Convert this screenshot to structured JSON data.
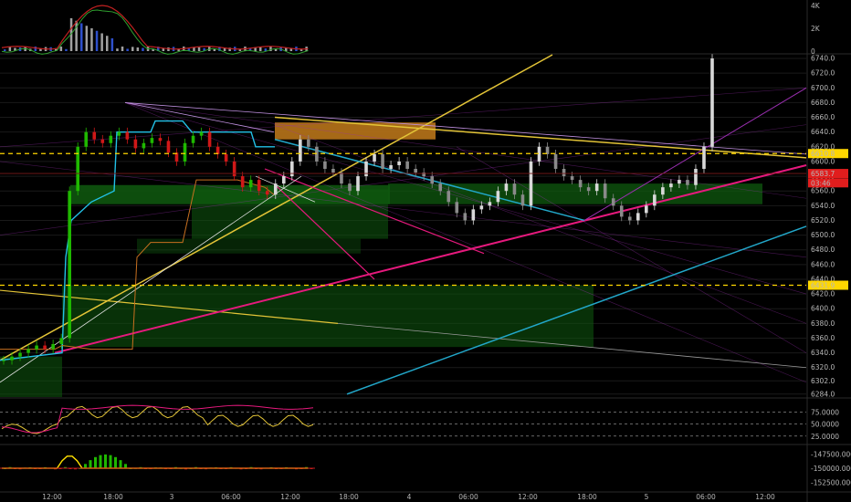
{
  "chart_data": {
    "type": "line",
    "colors": {
      "background": "#000000",
      "candle_up": "#1fb800",
      "candle_down": "#d01818",
      "price_line": "#ffd700",
      "level_marker": "#e11d1d",
      "grid": "#1a1a1a",
      "zone_green": "#0f5a0f",
      "zone_orange": "#b8741a",
      "trend_yellow": "#e3c437",
      "trend_magenta": "#e6197d",
      "trend_cyan": "#22a7c9",
      "trend_violet": "#9a2fb0"
    },
    "volume_pane": {
      "ticks": [
        {
          "value": 4000,
          "label": "4K"
        },
        {
          "value": 2000,
          "label": "2K"
        },
        {
          "value": 0,
          "label": "0"
        }
      ]
    },
    "main_pane": {
      "ylim": [
        6280,
        6745
      ],
      "ticks": [
        6740,
        6720,
        6700,
        6680,
        6660,
        6640,
        6620,
        6600,
        6580,
        6560,
        6540,
        6520,
        6500,
        6480,
        6460,
        6440,
        6420,
        6400,
        6380,
        6360,
        6340,
        6320,
        6302,
        6284
      ],
      "tick_labels": [
        "6740.0",
        "6720.0",
        "6700.0",
        "6680.0",
        "6660.0",
        "6640.0",
        "6620.0",
        "6600.0",
        "6580.0",
        "6560.0",
        "6540.0",
        "6520.0",
        "6500.0",
        "6480.0",
        "6460.0",
        "6440.0",
        "6420.0",
        "6400.0",
        "6380.0",
        "6360.0",
        "6340.0",
        "6320.0",
        "6302.0",
        "6284.0"
      ],
      "price_markers": [
        {
          "value": 6610.8,
          "label": "6610.8",
          "style": "yellow"
        },
        {
          "value": 6583.7,
          "label": "6583.7",
          "style": "red"
        },
        {
          "value": 6571,
          "label": "03:46",
          "style": "red"
        },
        {
          "value": 6431.9,
          "label": "6431.9",
          "style": "yellow"
        }
      ]
    },
    "oscillator_pane": {
      "ticks": [
        75,
        50,
        25
      ],
      "tick_labels": [
        "75.0000",
        "50.0000",
        "25.0000"
      ]
    },
    "histogram_pane": {
      "ticks": [
        -147500,
        -150000,
        -152500
      ],
      "tick_labels": [
        "-147500.0000",
        "-150000.0000",
        "-152500.0000"
      ]
    },
    "x_axis": {
      "labels": [
        "12:00",
        "18:00",
        "3",
        "06:00",
        "12:00",
        "18:00",
        "4",
        "06:00",
        "12:00",
        "18:00",
        "5",
        "06:00",
        "12:00"
      ]
    },
    "price_series": [
      6330,
      6335,
      6340,
      6345,
      6350,
      6345,
      6352,
      6360,
      6560,
      6620,
      6640,
      6630,
      6625,
      6635,
      6640,
      6630,
      6618,
      6625,
      6632,
      6628,
      6612,
      6600,
      6625,
      6635,
      6640,
      6620,
      6610,
      6600,
      6580,
      6565,
      6575,
      6560,
      6555,
      6570,
      6580,
      6600,
      6630,
      6620,
      6600,
      6590,
      6585,
      6570,
      6560,
      6580,
      6600,
      6610,
      6590,
      6595,
      6600,
      6590,
      6585,
      6580,
      6570,
      6560,
      6545,
      6530,
      6520,
      6535,
      6540,
      6545,
      6560,
      6570,
      6555,
      6540,
      6600,
      6620,
      6610,
      6590,
      6580,
      6575,
      6565,
      6560,
      6570,
      6550,
      6540,
      6525,
      6520,
      6530,
      6540,
      6555,
      6565,
      6570,
      6575,
      6568,
      6590,
      6620,
      6740
    ]
  }
}
